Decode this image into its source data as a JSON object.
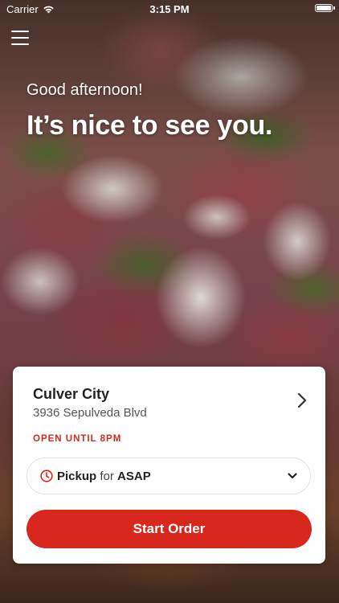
{
  "status_bar": {
    "carrier": "Carrier",
    "time": "3:15 PM",
    "icons": [
      "wifi-icon",
      "battery-icon"
    ]
  },
  "header": {
    "menu_icon": "hamburger-menu-icon",
    "greeting": "Good afternoon!",
    "headline": "It’s nice to see you."
  },
  "location_card": {
    "name": "Culver City",
    "address": "3936 Sepulveda Blvd",
    "open_status": "OPEN UNTIL 8PM",
    "detail_icon": "chevron-right-icon"
  },
  "order_options": {
    "mode": "Pickup",
    "connector": "for",
    "time": "ASAP",
    "icon": "clock-icon",
    "dropdown_icon": "chevron-down-icon"
  },
  "actions": {
    "start_order_label": "Start Order"
  },
  "colors": {
    "accent": "#d8271c",
    "status_text": "#d6291c",
    "card_background": "#ffffff"
  }
}
